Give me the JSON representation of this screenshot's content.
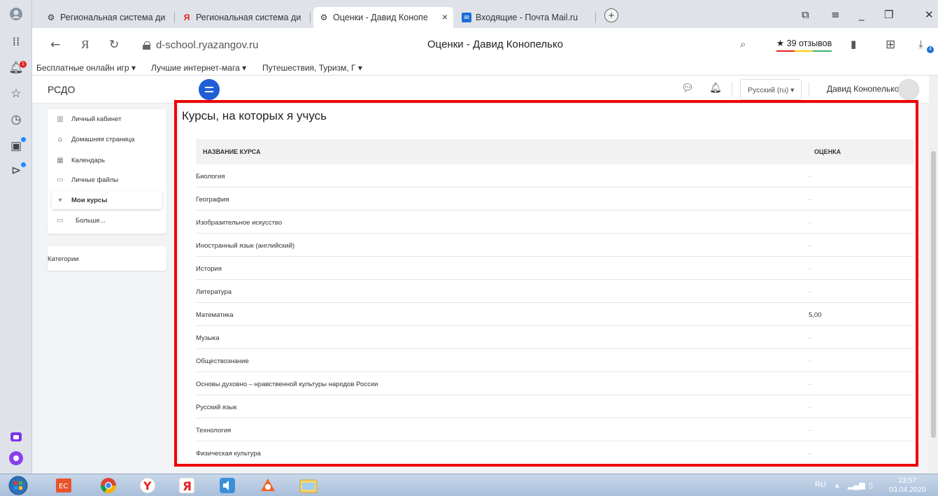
{
  "browser": {
    "tabs": [
      {
        "label": "Региональная система ди",
        "active": false
      },
      {
        "label": "Региональная система ди",
        "active": false
      },
      {
        "label": "Оценки - Давид Конопе",
        "active": true
      },
      {
        "label": "Входящие - Почта Mail.ru",
        "active": false
      }
    ],
    "tab_close": "×",
    "new_tab": "+",
    "address": "d-school.ryazangov.ru",
    "page_title": "Оценки - Давид Конопелько",
    "reviews": "★ 39 отзывов",
    "sidebar_badge": "1",
    "downloads_badge": "4",
    "bookmarks": [
      "Бесплатные онлайн игр ▾",
      "Лучшие интернет-мага ▾",
      "Путешествия, Туризм, Г ▾"
    ]
  },
  "site": {
    "brand": "РСДО",
    "language": "Русский (ru) ▾",
    "user_name": "Давид Конопелько"
  },
  "nav": {
    "items": [
      {
        "label": "Личный кабинет",
        "icon": "dashboard-icon",
        "glyph": "▥"
      },
      {
        "label": "Домашняя страница",
        "icon": "home-icon",
        "glyph": "⌂"
      },
      {
        "label": "Календарь",
        "icon": "calendar-icon",
        "glyph": "▦"
      },
      {
        "label": "Личные файлы",
        "icon": "files-icon",
        "glyph": "▭"
      },
      {
        "label": "Мои курсы",
        "icon": "chevron-down-icon",
        "glyph": "▾"
      },
      {
        "label": "Больше...",
        "icon": "folder-icon",
        "glyph": "▭"
      }
    ],
    "categories": "Категории"
  },
  "main": {
    "title": "Курсы, на которых я учусь",
    "col_course": "НАЗВАНИЕ КУРСА",
    "col_grade": "ОЦЕНКА",
    "rows": [
      {
        "course": "Биология",
        "grade": "-"
      },
      {
        "course": "География",
        "grade": "-"
      },
      {
        "course": "Изобразительное искусство",
        "grade": "-"
      },
      {
        "course": "Иностранный язык (английский)",
        "grade": "-"
      },
      {
        "course": "История",
        "grade": "-"
      },
      {
        "course": "Литература",
        "grade": "-"
      },
      {
        "course": "Математика",
        "grade": "5,00"
      },
      {
        "course": "Музыка",
        "grade": "-"
      },
      {
        "course": "Обществознание",
        "grade": "-"
      },
      {
        "course": "Основы духовно – нравственной культуры народов России",
        "grade": "-"
      },
      {
        "course": "Русский язык",
        "grade": "-"
      },
      {
        "course": "Технология",
        "grade": "-"
      },
      {
        "course": "Физическая культура",
        "grade": "-"
      }
    ]
  },
  "taskbar": {
    "lang": "RU",
    "time": "23:57",
    "date": "03.04.2020"
  },
  "colors": {
    "accent": "#1f5fd6",
    "highlight_border": "#ee0000"
  }
}
